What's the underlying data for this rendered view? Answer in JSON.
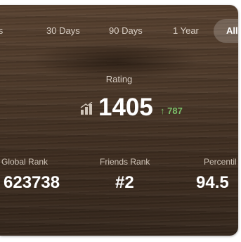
{
  "period_tabs": [
    {
      "label": "ays"
    },
    {
      "label": "30 Days"
    },
    {
      "label": "90 Days"
    },
    {
      "label": "1 Year"
    },
    {
      "label": "All"
    }
  ],
  "active_tab_index": 4,
  "rating": {
    "label": "Rating",
    "value": "1405",
    "change": "787",
    "change_color": "#7bbf6a"
  },
  "stats": {
    "global_rank": {
      "label": "Global Rank",
      "value": "623738"
    },
    "friends_rank": {
      "label": "Friends Rank",
      "value": "#2"
    },
    "percentile": {
      "label": "Percentil",
      "value": "94.5"
    }
  },
  "icons": {
    "rating": "trend-bars-icon",
    "change": "arrow-up-icon"
  }
}
